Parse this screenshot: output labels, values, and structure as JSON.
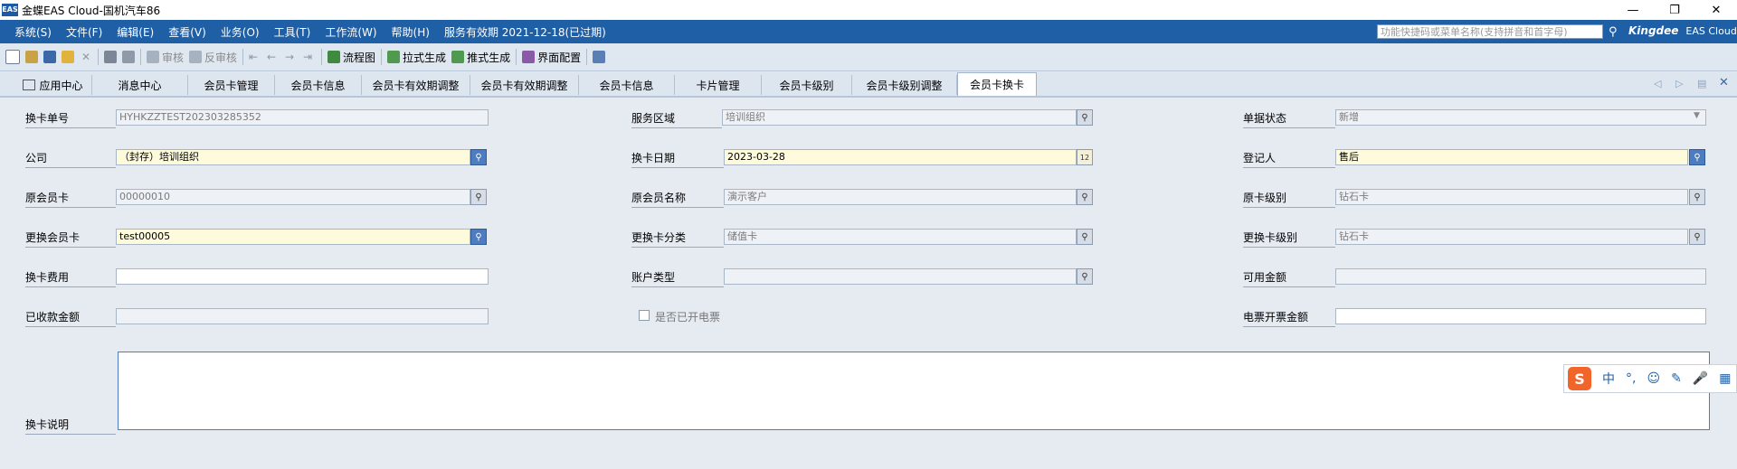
{
  "window": {
    "logo": "EAS",
    "title": "金蝶EAS Cloud-国机汽车86",
    "minimize": "—",
    "restore": "❐",
    "close": "✕"
  },
  "menu": {
    "items": [
      "系统(S)",
      "文件(F)",
      "编辑(E)",
      "查看(V)",
      "业务(O)",
      "工具(T)",
      "工作流(W)",
      "帮助(H)",
      "服务有效期 2021-12-18(已过期)"
    ],
    "search_placeholder": "功能快捷码或菜单名称(支持拼音和首字母)",
    "brand": "Kingdee",
    "product": "EAS Cloud"
  },
  "toolbar": {
    "audit": "审核",
    "unaudit": "反审核",
    "flowchart": "流程图",
    "pull": "拉式生成",
    "push": "推式生成",
    "ui_config": "界面配置"
  },
  "tabs": [
    "应用中心",
    "消息中心",
    "会员卡管理",
    "会员卡信息",
    "会员卡有效期调整",
    "会员卡有效期调整",
    "会员卡信息",
    "卡片管理",
    "会员卡级别",
    "会员卡级别调整",
    "会员卡换卡"
  ],
  "form": {
    "card_no_label": "换卡单号",
    "card_no": "HYHKZZTEST202303285352",
    "service_area_label": "服务区域",
    "service_area": "培训组织",
    "doc_status_label": "单据状态",
    "doc_status": "新增",
    "company_label": "公司",
    "company": "（封存）培训组织",
    "change_date_label": "换卡日期",
    "change_date": "2023-03-28",
    "registrant_label": "登记人",
    "registrant": "售后",
    "orig_card_label": "原会员卡",
    "orig_card": "00000010",
    "orig_member_name_label": "原会员名称",
    "orig_member_name": "演示客户",
    "orig_card_level_label": "原卡级别",
    "orig_card_level": "钻石卡",
    "new_card_label": "更换会员卡",
    "new_card": "test00005",
    "new_card_type_label": "更换卡分类",
    "new_card_type": "储值卡",
    "new_card_level_label": "更换卡级别",
    "new_card_level": "钻石卡",
    "fee_label": "换卡费用",
    "fee": "",
    "account_type_label": "账户类型",
    "account_type": "",
    "available_label": "可用金额",
    "available": "",
    "received_label": "已收款金额",
    "received": "",
    "einvoice_label": "是否已开电票",
    "einvoice_checked": false,
    "einvoice_amount_label": "电票开票金额",
    "einvoice_amount": "",
    "remark_label": "换卡说明",
    "remark": ""
  },
  "ime": {
    "logo": "S",
    "mode": "中",
    "punct": "°,",
    "emoji": "☺",
    "pen": "✎",
    "mic": "🎤",
    "grid": "▦"
  }
}
